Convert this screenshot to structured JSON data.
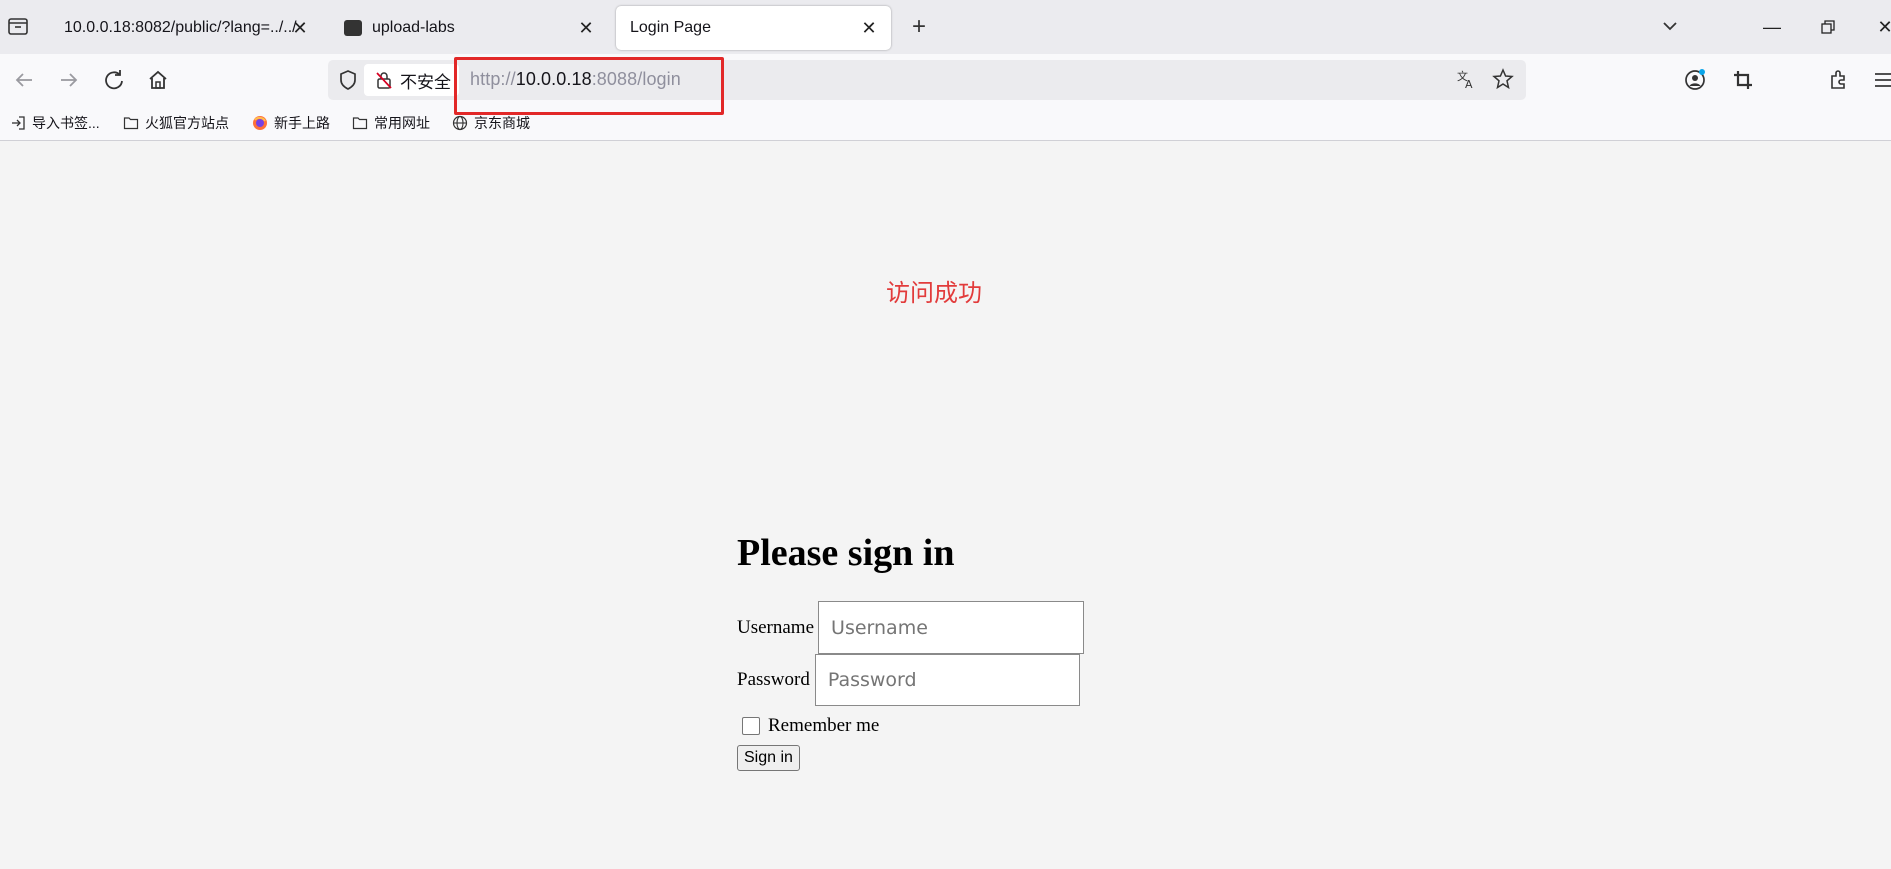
{
  "browser": {
    "tabs": [
      {
        "title": "10.0.0.18:8082/public/?lang=../../",
        "active": false
      },
      {
        "title": "upload-labs",
        "active": false
      },
      {
        "title": "Login Page",
        "active": true
      }
    ],
    "url": {
      "scheme": "http://",
      "host": "10.0.0.18",
      "rest": ":8088/login"
    },
    "security_label": "不安全",
    "bookmarks": [
      {
        "label": "导入书签...",
        "icon": "import-icon"
      },
      {
        "label": "火狐官方站点",
        "icon": "folder-icon"
      },
      {
        "label": "新手上路",
        "icon": "firefox-icon"
      },
      {
        "label": "常用网址",
        "icon": "folder-icon"
      },
      {
        "label": "京东商城",
        "icon": "globe-icon"
      }
    ]
  },
  "page": {
    "status_message": "访问成功",
    "status_color": "#e23b3b",
    "heading": "Please sign in",
    "username_label": "Username",
    "username_placeholder": "Username",
    "password_label": "Password",
    "password_placeholder": "Password",
    "remember_label": "Remember me",
    "remember_checked": false,
    "signin_label": "Sign in"
  },
  "annotation": {
    "color": "#e22828"
  }
}
